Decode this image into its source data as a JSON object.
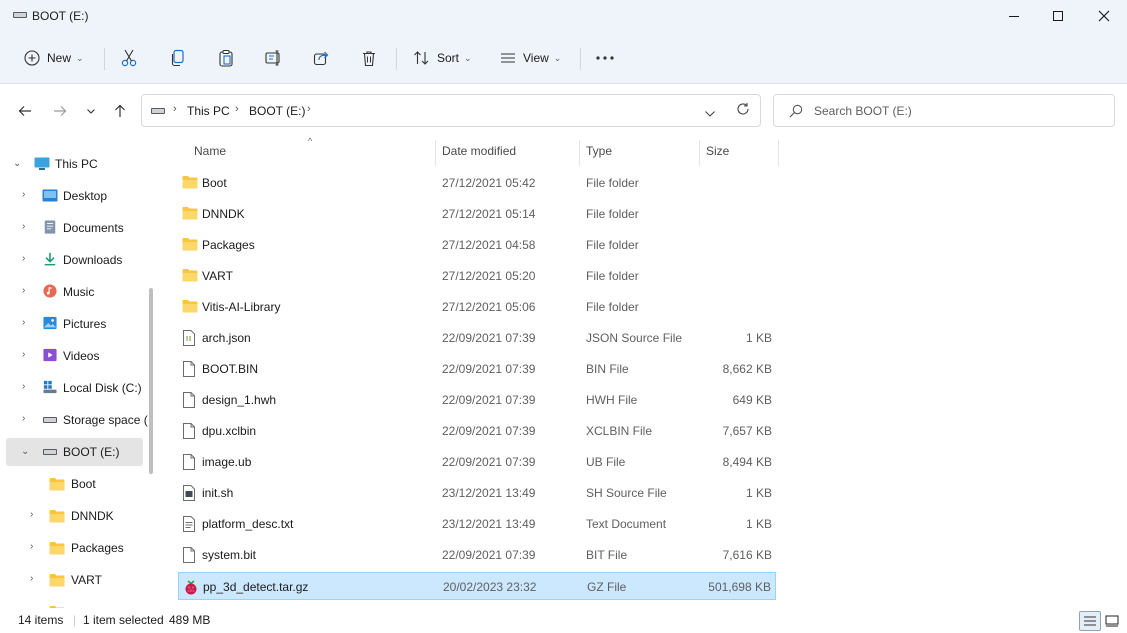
{
  "window": {
    "title": "BOOT (E:)"
  },
  "toolbar": {
    "new_label": "New",
    "sort_label": "Sort",
    "view_label": "View"
  },
  "address": {
    "crumbs": [
      "This PC",
      "BOOT (E:)"
    ],
    "search_placeholder": "Search BOOT (E:)"
  },
  "nav": {
    "items": [
      {
        "label": "This PC",
        "icon": "computer-icon"
      },
      {
        "label": "Desktop",
        "icon": "desktop-icon"
      },
      {
        "label": "Documents",
        "icon": "documents-icon"
      },
      {
        "label": "Downloads",
        "icon": "download-icon"
      },
      {
        "label": "Music",
        "icon": "music-icon"
      },
      {
        "label": "Pictures",
        "icon": "pictures-icon"
      },
      {
        "label": "Videos",
        "icon": "videos-icon"
      },
      {
        "label": "Local Disk (C:)",
        "icon": "windows-drive-icon"
      },
      {
        "label": "Storage space (",
        "icon": "drive-icon"
      },
      {
        "label": "BOOT (E:)",
        "icon": "drive-icon"
      },
      {
        "label": "Boot",
        "icon": "folder-icon"
      },
      {
        "label": "DNNDK",
        "icon": "folder-icon"
      },
      {
        "label": "Packages",
        "icon": "folder-icon"
      },
      {
        "label": "VART",
        "icon": "folder-icon"
      }
    ]
  },
  "columns": {
    "name": "Name",
    "date": "Date modified",
    "type": "Type",
    "size": "Size"
  },
  "files": [
    {
      "name": "Boot",
      "date": "27/12/2021 05:42",
      "type": "File folder",
      "size": "",
      "icon": "folder-icon"
    },
    {
      "name": "DNNDK",
      "date": "27/12/2021 05:14",
      "type": "File folder",
      "size": "",
      "icon": "folder-icon"
    },
    {
      "name": "Packages",
      "date": "27/12/2021 04:58",
      "type": "File folder",
      "size": "",
      "icon": "folder-icon"
    },
    {
      "name": "VART",
      "date": "27/12/2021 05:20",
      "type": "File folder",
      "size": "",
      "icon": "folder-icon"
    },
    {
      "name": "Vitis-AI-Library",
      "date": "27/12/2021 05:06",
      "type": "File folder",
      "size": "",
      "icon": "folder-icon"
    },
    {
      "name": "arch.json",
      "date": "22/09/2021 07:39",
      "type": "JSON Source File",
      "size": "1 KB",
      "icon": "json-file-icon"
    },
    {
      "name": "BOOT.BIN",
      "date": "22/09/2021 07:39",
      "type": "BIN File",
      "size": "8,662 KB",
      "icon": "file-icon"
    },
    {
      "name": "design_1.hwh",
      "date": "22/09/2021 07:39",
      "type": "HWH File",
      "size": "649 KB",
      "icon": "file-icon"
    },
    {
      "name": "dpu.xclbin",
      "date": "22/09/2021 07:39",
      "type": "XCLBIN File",
      "size": "7,657 KB",
      "icon": "file-icon"
    },
    {
      "name": "image.ub",
      "date": "22/09/2021 07:39",
      "type": "UB File",
      "size": "8,494 KB",
      "icon": "file-icon"
    },
    {
      "name": "init.sh",
      "date": "23/12/2021 13:49",
      "type": "SH Source File",
      "size": "1 KB",
      "icon": "script-file-icon"
    },
    {
      "name": "platform_desc.txt",
      "date": "23/12/2021 13:49",
      "type": "Text Document",
      "size": "1 KB",
      "icon": "text-file-icon"
    },
    {
      "name": "system.bit",
      "date": "22/09/2021 07:39",
      "type": "BIT File",
      "size": "7,616 KB",
      "icon": "file-icon"
    },
    {
      "name": "pp_3d_detect.tar.gz",
      "date": "20/02/2023 23:32",
      "type": "GZ File",
      "size": "501,698 KB",
      "icon": "raspberry-archive-icon",
      "selected": true
    }
  ],
  "status": {
    "count": "14 items",
    "selection": "1 item selected",
    "selection_size": "489 MB"
  },
  "colors": {
    "chrome_bg": "#eef4f9",
    "selection_bg": "#cce8ff",
    "selection_border": "#99d1ff",
    "folder_yellow": "#f8c640"
  }
}
